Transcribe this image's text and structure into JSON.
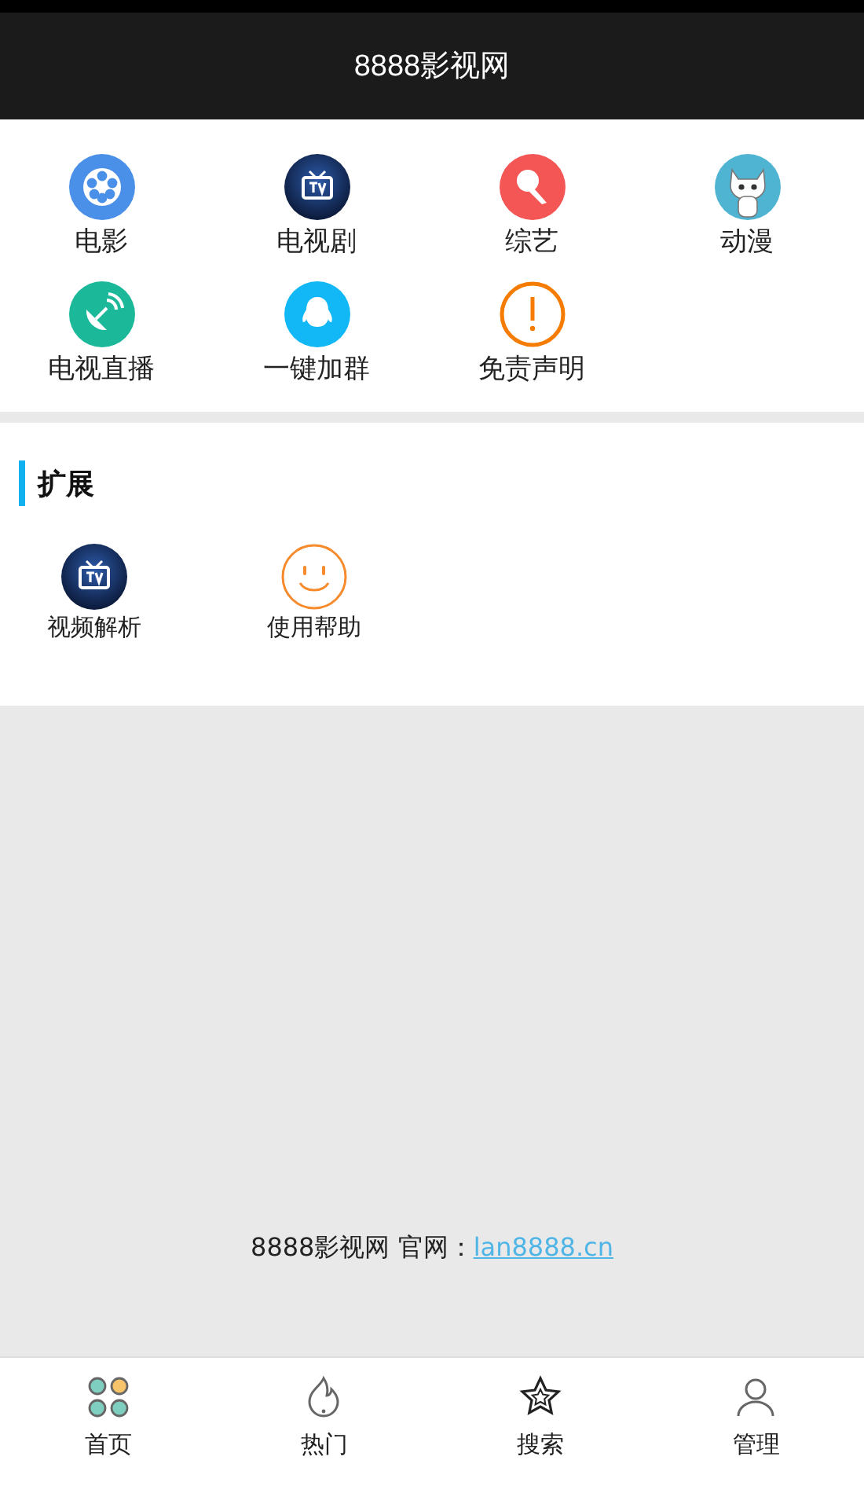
{
  "header": {
    "title": "8888影视网"
  },
  "main_grid": [
    {
      "label": "电影",
      "kind": "film"
    },
    {
      "label": "电视剧",
      "kind": "tv"
    },
    {
      "label": "综艺",
      "kind": "mic"
    },
    {
      "label": "动漫",
      "kind": "cat"
    },
    {
      "label": "电视直播",
      "kind": "satellite"
    },
    {
      "label": "一键加群",
      "kind": "penguin"
    },
    {
      "label": "免责声明",
      "kind": "alert"
    }
  ],
  "extension": {
    "title": "扩展",
    "items": [
      {
        "label": "视频解析",
        "kind": "tv"
      },
      {
        "label": "使用帮助",
        "kind": "smile"
      }
    ]
  },
  "footer": {
    "text": "8888影视网 官网：",
    "link": "lan8888.cn"
  },
  "tab_bar": [
    {
      "label": "首页",
      "kind": "dots"
    },
    {
      "label": "热门",
      "kind": "flame"
    },
    {
      "label": "搜索",
      "kind": "star"
    },
    {
      "label": "管理",
      "kind": "person"
    }
  ]
}
